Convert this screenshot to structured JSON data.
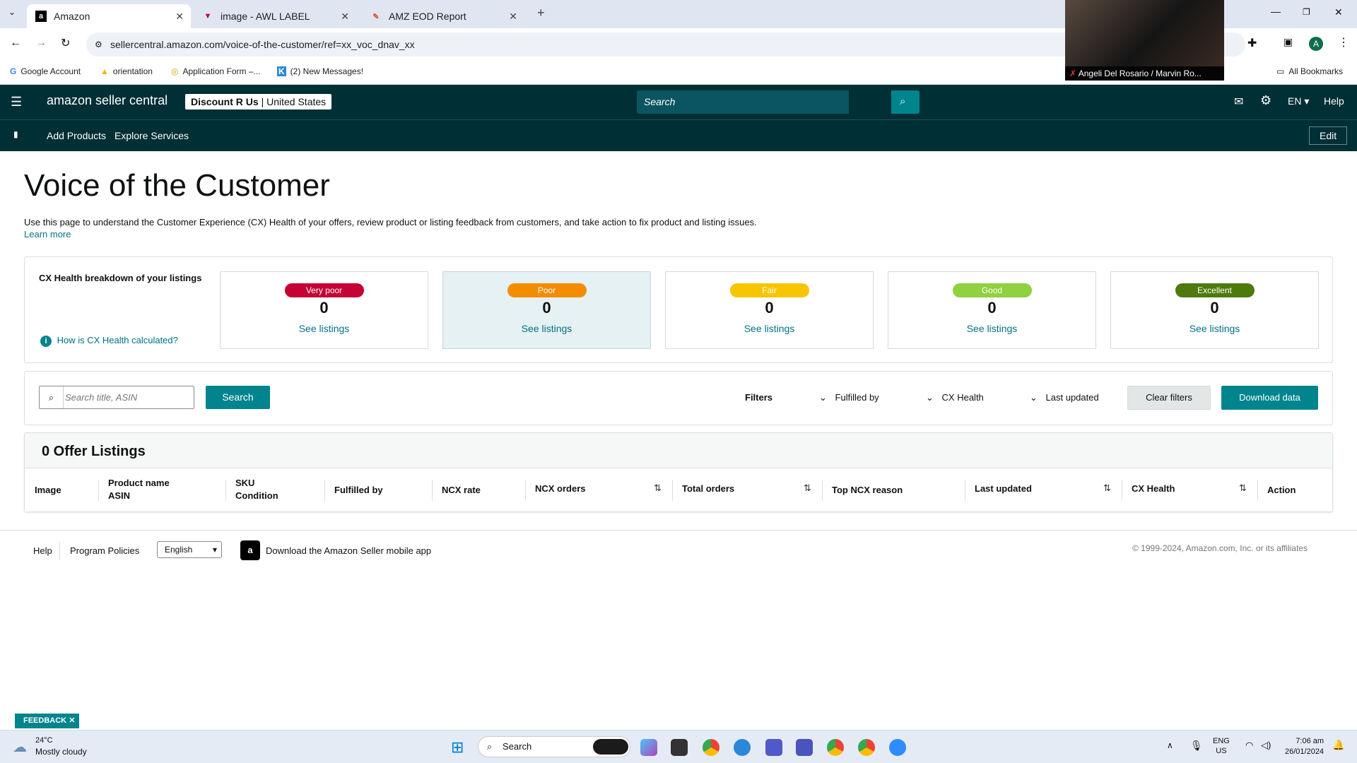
{
  "browser": {
    "tabs": [
      {
        "title": "Amazon"
      },
      {
        "title": "image - AWL LABEL"
      },
      {
        "title": "AMZ EOD Report"
      }
    ],
    "url": "sellercentral.amazon.com/voice-of-the-customer/ref=xx_voc_dnav_xx",
    "bookmarks": [
      "Google Account",
      "orientation",
      "Application Form –...",
      "(2) New Messages!"
    ],
    "all_bookmarks": "All Bookmarks",
    "profile_initial": "A",
    "video_caption": "Angeli Del Rosario / Marvin Ro..."
  },
  "header": {
    "logo": "amazon seller central",
    "store": "Discount R Us",
    "marketplace": "United States",
    "search_placeholder": "Search",
    "language": "EN",
    "help": "Help"
  },
  "nav": {
    "items": [
      "Add Products",
      "Explore Services"
    ],
    "edit": "Edit"
  },
  "page": {
    "title": "Voice of the Customer",
    "intro": "Use this page to understand the Customer Experience (CX) Health of your offers, review product or listing feedback from customers, and take action to fix product and listing issues.",
    "learn_more": "Learn more"
  },
  "cx": {
    "heading": "CX Health breakdown of your listings",
    "how_link": "How is CX Health calculated?",
    "cards": [
      {
        "label": "Very poor",
        "count": "0",
        "link": "See listings",
        "color": "#c40233"
      },
      {
        "label": "Poor",
        "count": "0",
        "link": "See listings",
        "color": "#f28d00"
      },
      {
        "label": "Fair",
        "count": "0",
        "link": "See listings",
        "color": "#f6c500"
      },
      {
        "label": "Good",
        "count": "0",
        "link": "See listings",
        "color": "#8fd13e"
      },
      {
        "label": "Excellent",
        "count": "0",
        "link": "See listings",
        "color": "#4d7a0b"
      }
    ]
  },
  "filters": {
    "search_placeholder": "Search title, ASIN",
    "search_button": "Search",
    "filters_label": "Filters",
    "fulfilled_by": "Fulfilled by",
    "cx_health": "CX Health",
    "last_updated": "Last updated",
    "clear": "Clear filters",
    "download": "Download data"
  },
  "listings": {
    "title": "0 Offer Listings",
    "columns": {
      "image": "Image",
      "product_name": "Product name",
      "asin": "ASIN",
      "sku": "SKU",
      "condition": "Condition",
      "fulfilled_by": "Fulfilled by",
      "ncx_rate": "NCX rate",
      "ncx_orders": "NCX orders",
      "total_orders": "Total orders",
      "top_ncx_reason": "Top NCX reason",
      "last_updated": "Last updated",
      "cx_health": "CX Health",
      "action": "Action"
    }
  },
  "footer": {
    "help": "Help",
    "policies": "Program Policies",
    "language": "English",
    "app": "Download the Amazon Seller mobile app",
    "copyright": "© 1999-2024, Amazon.com, Inc. or its affiliates"
  },
  "feedback": "FEEDBACK",
  "taskbar": {
    "temp": "24°C",
    "weather": "Mostly cloudy",
    "search": "Search",
    "lang1": "ENG",
    "lang2": "US",
    "time": "7:06 am",
    "date": "26/01/2024"
  }
}
